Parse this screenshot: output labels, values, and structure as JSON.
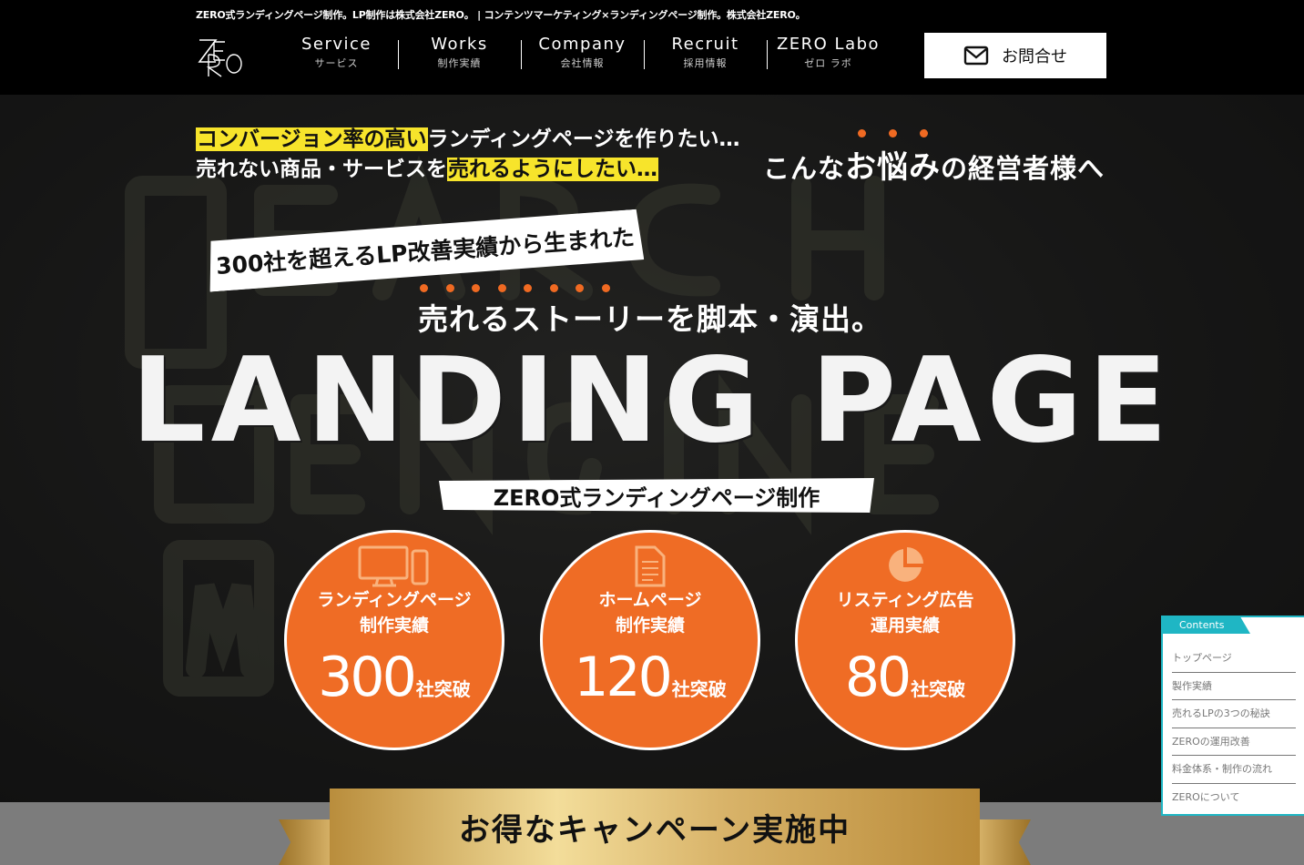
{
  "header": {
    "tagline": "ZERO式ランディングページ制作。LP制作は株式会社ZERO。 | コンテンツマーケティング×ランディングページ制作。株式会社ZERO。",
    "logo_text": "ZERO",
    "nav": [
      {
        "en": "Service",
        "ja": "サービス"
      },
      {
        "en": "Works",
        "ja": "制作実績"
      },
      {
        "en": "Company",
        "ja": "会社情報"
      },
      {
        "en": "Recruit",
        "ja": "採用情報"
      },
      {
        "en": "ZERO Labo",
        "ja": "ゼロ ラボ"
      }
    ],
    "contact_label": "お問合せ"
  },
  "hero": {
    "lead1_hl": "コンバージョン率の高い",
    "lead1_rest": "ランディングページを作りたい…",
    "lead2_pre": "売れない商品・サービスを",
    "lead2_hl": "売れるようにしたい…",
    "worry_pre": "こんな",
    "worry_dots": "お悩み",
    "worry_post": "の経営者様へ",
    "badge": "300社を超えるLP改善実績から生まれた",
    "story_dots": "売れるストーリー",
    "story_rest": "を脚本・演出。",
    "big_title": "LANDING PAGE",
    "subtitle": "ZERO式ランディングページ制作",
    "stats": [
      {
        "title1": "ランディングページ",
        "title2": "制作実績",
        "number": "300",
        "suffix": "社突破",
        "icon": "devices-icon"
      },
      {
        "title1": "ホームページ",
        "title2": "制作実績",
        "number": "120",
        "suffix": "社突破",
        "icon": "document-icon"
      },
      {
        "title1": "リスティング広告",
        "title2": "運用実績",
        "number": "80",
        "suffix": "社突破",
        "icon": "pie-chart-icon"
      }
    ]
  },
  "campaign": {
    "label": "お得なキャンペーン実施中"
  },
  "contents": {
    "tab": "Contents",
    "items": [
      "トップページ",
      "製作実績",
      "売れるLPの3つの秘訣",
      "ZEROの運用改善",
      "料金体系・制作の流れ",
      "ZEROについて"
    ]
  },
  "colors": {
    "accent_orange": "#ef6c25",
    "highlight_yellow": "#f7e42b",
    "sidebar_teal": "#1fb6c4"
  }
}
